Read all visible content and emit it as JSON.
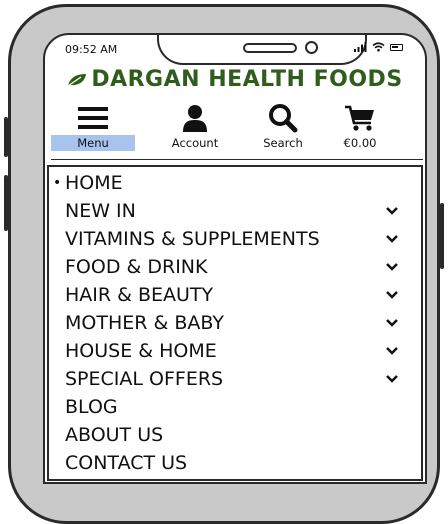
{
  "status_bar": {
    "time": "09:52 AM"
  },
  "brand": {
    "name": "DARGAN HEALTH FOODS",
    "color": "#2f5d1b"
  },
  "nav": {
    "items": [
      {
        "label": "Menu",
        "icon": "hamburger-icon",
        "active": true
      },
      {
        "label": "Account",
        "icon": "user-icon"
      },
      {
        "label": "Search",
        "icon": "search-icon"
      },
      {
        "label": "€0.00",
        "icon": "cart-icon"
      }
    ],
    "active_color": "#a8c4ee"
  },
  "menu": {
    "items": [
      {
        "label": "HOME",
        "current": true,
        "expandable": false
      },
      {
        "label": "NEW IN",
        "expandable": true
      },
      {
        "label": "VITAMINS & SUPPLEMENTS",
        "expandable": true
      },
      {
        "label": "FOOD & DRINK",
        "expandable": true
      },
      {
        "label": "HAIR & BEAUTY",
        "expandable": true
      },
      {
        "label": "MOTHER & BABY",
        "expandable": true
      },
      {
        "label": "HOUSE & HOME",
        "expandable": true
      },
      {
        "label": "SPECIAL OFFERS",
        "expandable": true
      },
      {
        "label": "BLOG",
        "expandable": false
      },
      {
        "label": "ABOUT US",
        "expandable": false
      },
      {
        "label": "CONTACT US",
        "expandable": false
      }
    ]
  }
}
